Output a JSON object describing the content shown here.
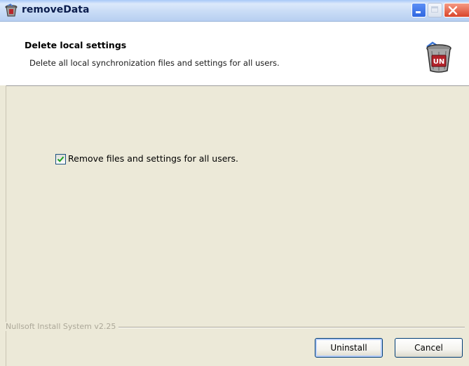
{
  "window": {
    "title": "removeData",
    "icon": "recycle-bin-icon"
  },
  "header": {
    "title": "Delete local settings",
    "subtitle": "Delete all local synchronization files and settings for all users.",
    "icon": "uninstall-bin-icon",
    "icon_text": "UN"
  },
  "options": {
    "remove_all_label": "Remove files and settings for all users.",
    "remove_all_checked": true
  },
  "footer": {
    "branding": "Nullsoft Install System v2.25",
    "uninstall_label": "Uninstall",
    "cancel_label": "Cancel"
  }
}
